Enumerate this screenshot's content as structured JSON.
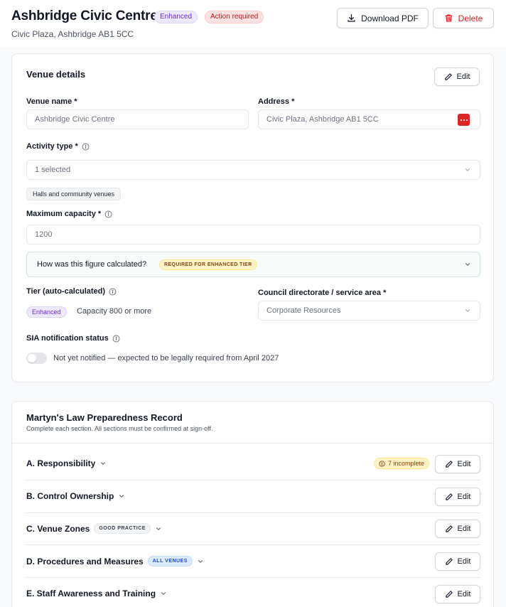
{
  "header": {
    "title": "Ashbridge Civic Centre",
    "badge_tier": "Enhanced",
    "badge_status": "Action required",
    "subtitle": "Civic Plaza, Ashbridge AB1 5CC",
    "download_label": "Download PDF",
    "delete_label": "Delete"
  },
  "venue": {
    "card_title": "Venue details",
    "edit_label": "Edit",
    "name_label": "Venue name *",
    "name_value": "Ashbridge Civic Centre",
    "address_label": "Address *",
    "address_value": "Civic Plaza, Ashbridge AB1 5CC",
    "activity_label": "Activity type *",
    "activity_value": "1 selected",
    "activity_chip": "Halls and community venues",
    "capacity_label": "Maximum capacity *",
    "capacity_value": "1200",
    "calc_question": "How was this figure calculated?",
    "calc_badge": "REQUIRED FOR ENHANCED TIER",
    "tier_label": "Tier (auto-calculated)",
    "tier_badge": "Enhanced",
    "tier_text": "Capacity 800 or more",
    "directorate_label": "Council directorate / service area *",
    "directorate_value": "Corporate Resources",
    "sia_label": "SIA notification status",
    "sia_text": "Not yet notified — expected to be legally required from April 2027",
    "sia_notified": false
  },
  "record": {
    "title": "Martyn's Law Preparedness Record",
    "subtitle": "Complete each section. All sections must be confirmed at sign-off.",
    "sections": [
      {
        "label": "A. Responsibility",
        "incomplete": "7 incomplete",
        "edit": "Edit"
      },
      {
        "label": "B. Control Ownership",
        "edit": "Edit"
      },
      {
        "label": "C. Venue Zones",
        "tag": "GOOD PRACTICE",
        "edit": "Edit"
      },
      {
        "label": "D. Procedures and Measures",
        "tag": "ALL VENUES",
        "edit": "Edit"
      },
      {
        "label": "E. Staff Awareness and Training",
        "edit": "Edit"
      }
    ]
  },
  "colors": {
    "danger": "#dc2626",
    "tier_purple": "#6d28d9",
    "warning_amber": "#92400e",
    "info_blue": "#1d4ed8"
  }
}
